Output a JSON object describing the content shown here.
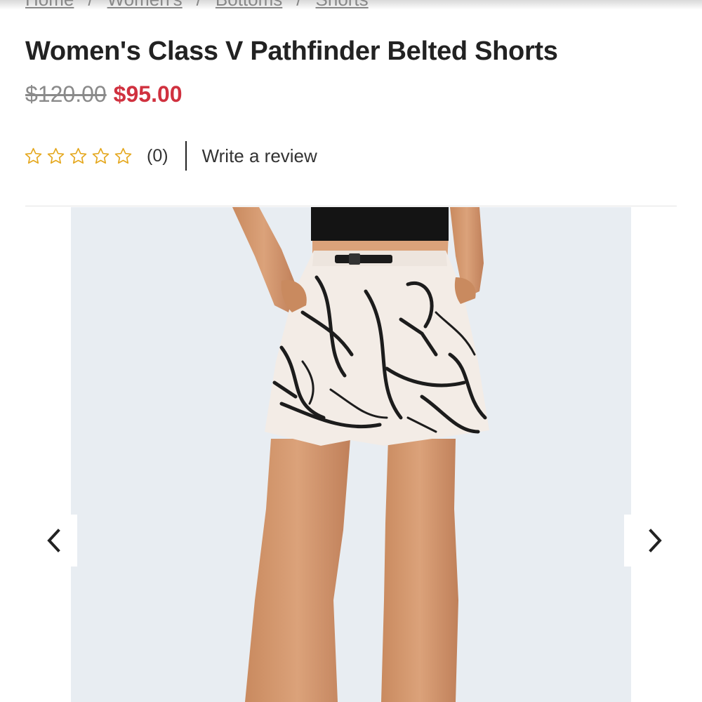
{
  "breadcrumb": {
    "items": [
      "Home",
      "Women's",
      "Bottoms",
      "Shorts"
    ],
    "separator": "/"
  },
  "product": {
    "title": "Women's Class V Pathfinder Belted Shorts",
    "price_original": "$120.00",
    "price_sale": "$95.00",
    "rating_stars": 0,
    "rating_max": 5,
    "review_count": "(0)",
    "write_review_label": "Write a review"
  },
  "gallery": {
    "prev_icon": "chevron-left-icon",
    "next_icon": "chevron-right-icon"
  },
  "colors": {
    "sale_price": "#d0313f",
    "star_outline": "#e5a81f",
    "image_background": "#e8edf2"
  }
}
